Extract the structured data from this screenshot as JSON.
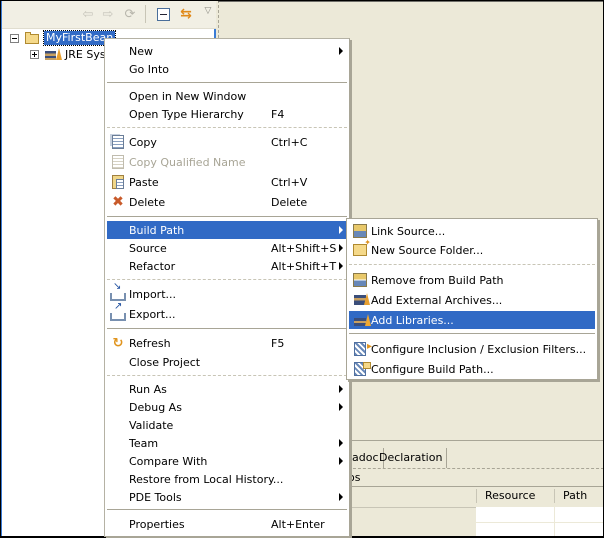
{
  "explorer": {
    "toolbar": {
      "back_icon": "⇦",
      "forward_icon": "⇨",
      "up_icon": "⟳",
      "link_icon": "⇆",
      "menu_icon": "▽"
    },
    "tree": [
      {
        "label": "MyFirstBean",
        "expanded": true,
        "selected": true,
        "icon": "project-folder-icon"
      },
      {
        "label": "JRE Syst",
        "expanded": false,
        "selected": false,
        "icon": "jre-library-icon"
      }
    ]
  },
  "context_menu": {
    "items": [
      {
        "label": "New",
        "shortcut": "",
        "submenu": true
      },
      {
        "label": "Go Into",
        "shortcut": "",
        "submenu": false
      },
      {
        "label": "Open in New Window",
        "shortcut": "",
        "submenu": false
      },
      {
        "label": "Open Type Hierarchy",
        "shortcut": "F4",
        "submenu": false
      },
      {
        "label": "Copy",
        "shortcut": "Ctrl+C",
        "icon": "copy-icon"
      },
      {
        "label": "Copy Qualified Name",
        "shortcut": "",
        "icon": "copy-qualified-name-icon",
        "disabled": true
      },
      {
        "label": "Paste",
        "shortcut": "Ctrl+V",
        "icon": "paste-icon"
      },
      {
        "label": "Delete",
        "shortcut": "Delete",
        "icon": "delete-icon",
        "icon_glyph": "✖"
      },
      {
        "label": "Build Path",
        "shortcut": "",
        "submenu": true,
        "selected": true
      },
      {
        "label": "Source",
        "shortcut": "Alt+Shift+S",
        "submenu": true
      },
      {
        "label": "Refactor",
        "shortcut": "Alt+Shift+T",
        "submenu": true
      },
      {
        "label": "Import...",
        "shortcut": "",
        "icon": "import-icon"
      },
      {
        "label": "Export...",
        "shortcut": "",
        "icon": "export-icon"
      },
      {
        "label": "Refresh",
        "shortcut": "F5",
        "icon": "refresh-icon",
        "icon_glyph": "↻"
      },
      {
        "label": "Close Project",
        "shortcut": ""
      },
      {
        "label": "Run As",
        "shortcut": "",
        "submenu": true
      },
      {
        "label": "Debug As",
        "shortcut": "",
        "submenu": true
      },
      {
        "label": "Validate",
        "shortcut": ""
      },
      {
        "label": "Team",
        "shortcut": "",
        "submenu": true
      },
      {
        "label": "Compare With",
        "shortcut": "",
        "submenu": true
      },
      {
        "label": "Restore from Local History...",
        "shortcut": ""
      },
      {
        "label": "PDE Tools",
        "shortcut": "",
        "submenu": true
      },
      {
        "label": "Properties",
        "shortcut": "Alt+Enter"
      }
    ]
  },
  "build_path_submenu": {
    "items": [
      {
        "label": "Link Source...",
        "icon": "link-source-icon"
      },
      {
        "label": "New Source Folder...",
        "icon": "new-source-folder-icon"
      },
      {
        "label": "Remove from Build Path",
        "icon": "remove-from-build-path-icon"
      },
      {
        "label": "Add External Archives...",
        "icon": "add-external-archives-icon"
      },
      {
        "label": "Add Libraries...",
        "icon": "add-libraries-icon",
        "selected": true
      },
      {
        "label": "Configure Inclusion / Exclusion Filters...",
        "icon": "configure-filters-icon"
      },
      {
        "label": "Configure Build Path...",
        "icon": "configure-build-path-icon"
      }
    ]
  },
  "bottom_panel": {
    "tabs": [
      {
        "label": "adoc"
      },
      {
        "label": "Declaration"
      }
    ],
    "view_label": "os",
    "columns": [
      "Resource",
      "Path"
    ]
  },
  "colors": {
    "selection": "#316ac5",
    "focus_border": "#3a7bd5",
    "background": "#ece9d8"
  }
}
